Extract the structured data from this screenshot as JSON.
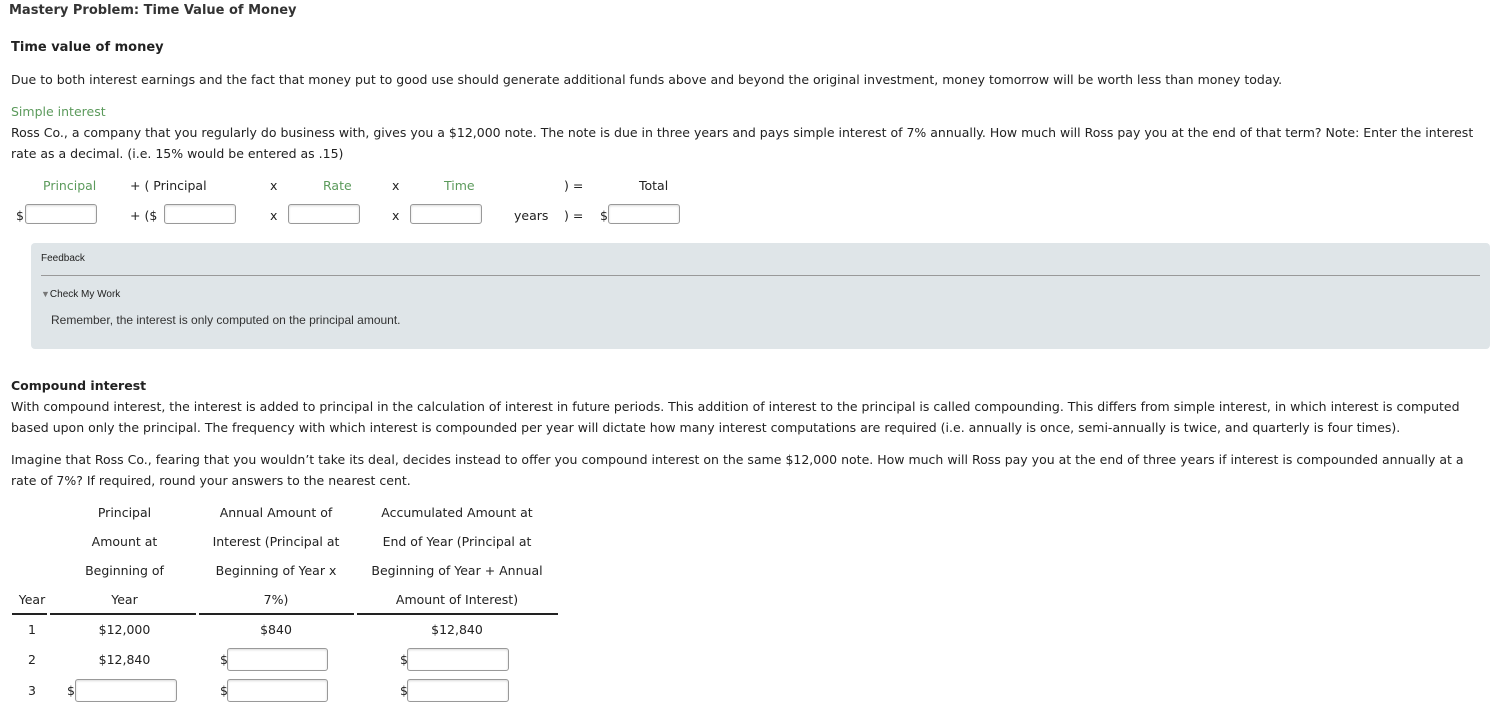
{
  "title": "Mastery Problem: Time Value of Money",
  "section_heading": "Time value of money",
  "intro": "Due to both interest earnings and the fact that money put to good use should generate additional funds above and beyond the original investment, money tomorrow will be worth less than money today.",
  "simple": {
    "heading": "Simple interest",
    "question": "Ross Co., a company that you regularly do business with, gives you a $12,000 note. The note is due in three years and pays simple interest of 7% annually. How much will Ross pay you at the end of that term? Note: Enter the interest rate as a decimal. (i.e. 15% would be entered as .15)",
    "labels": {
      "principal": "Principal",
      "plus_open": "+  ( Principal",
      "x1": "x",
      "rate": "Rate",
      "x2": "x",
      "time": "Time",
      "close_eq": ")   =",
      "total": "Total"
    },
    "row": {
      "dollar1": "$",
      "plus_open": "+  ($",
      "x1": "x",
      "x2": "x",
      "years": "years",
      "close_eq": ")   =",
      "dollar2": "$"
    },
    "inputs": {
      "principal": "",
      "principal2": "",
      "rate": "",
      "time": "",
      "total": ""
    }
  },
  "feedback": {
    "label": "Feedback",
    "check": "Check My Work",
    "message": "Remember, the interest is only computed on the principal amount."
  },
  "compound": {
    "heading": "Compound interest",
    "para1": "With compound interest, the interest is added to principal in the calculation of interest in future periods. This addition of interest to the principal is called compounding. This differs from simple interest, in which interest is computed based upon only the principal. The frequency with which interest is compounded per year will dictate how many interest computations are required (i.e. annually is once, semi-annually is twice, and quarterly is four times).",
    "para2": "Imagine that Ross Co., fearing that you wouldn’t take its deal, decides instead to offer you compound interest on the same $12,000 note. How much will Ross pay you at the end of three years if interest is compounded annually at a rate of 7%? If required, round your answers to the nearest cent.",
    "table": {
      "headers": [
        [
          "",
          "",
          "",
          "Year"
        ],
        [
          "Principal",
          "Amount at",
          "Beginning of",
          "Year"
        ],
        [
          "Annual Amount of",
          "Interest (Principal at",
          "Beginning of Year x",
          "7%)"
        ],
        [
          "Accumulated Amount at",
          "End of Year (Principal at",
          "Beginning of Year + Annual",
          "Amount of Interest)"
        ]
      ],
      "rows": [
        {
          "year": "1",
          "principal": "$12,000",
          "interest": "$840",
          "accumulated": "$12,840"
        },
        {
          "year": "2",
          "principal": "$12,840",
          "interest": "",
          "accumulated": ""
        },
        {
          "year": "3",
          "principal": "",
          "interest": "",
          "accumulated": ""
        }
      ],
      "dollar": "$"
    }
  }
}
